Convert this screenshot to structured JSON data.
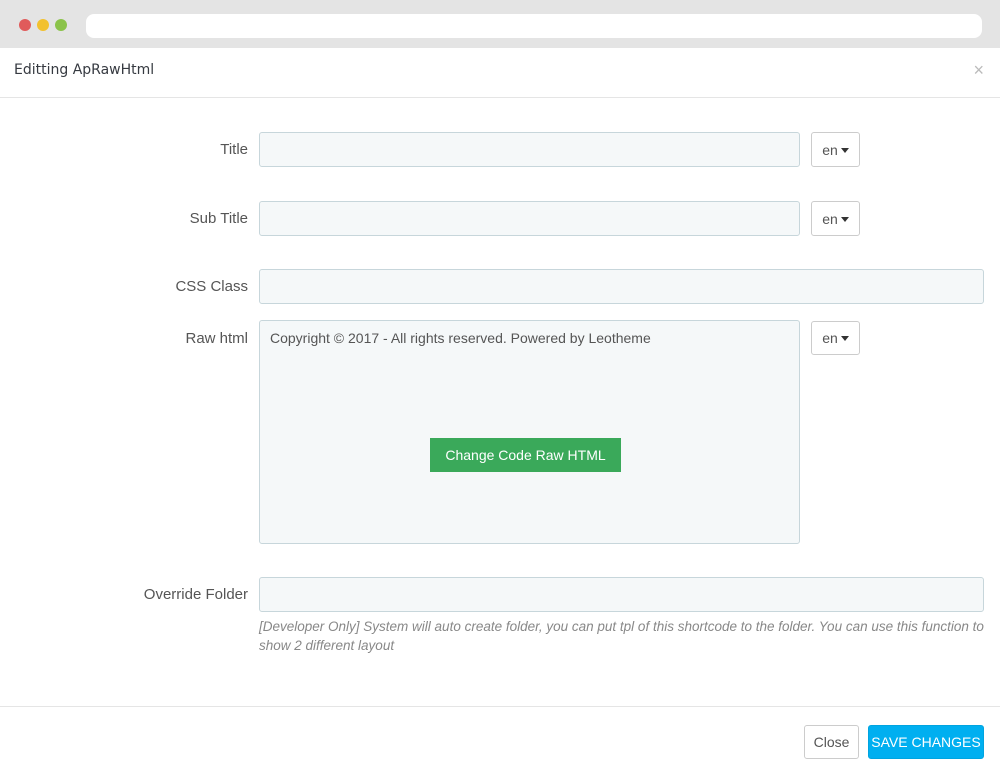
{
  "modal": {
    "title": "Editting ApRawHtml",
    "close_glyph": "×"
  },
  "form": {
    "title_label": "Title",
    "subtitle_label": "Sub Title",
    "css_class_label": "CSS Class",
    "raw_html_label": "Raw html",
    "override_folder_label": "Override Folder",
    "title_value": "",
    "subtitle_value": "",
    "css_class_value": "",
    "override_folder_value": "",
    "lang": "en",
    "raw_html_value": "Copyright © 2017 - All rights reserved. Powered by Leotheme",
    "change_code_button": "Change Code Raw HTML",
    "help_text": "[Developer Only] System will auto create folder, you can put tpl of this shortcode to the folder. You can use this function to show 2 different layout"
  },
  "footer": {
    "close_label": "Close",
    "save_label": "SAVE CHANGES"
  },
  "colors": {
    "save_button": "#00aff0",
    "change_code_button": "#3aa95a",
    "field_background": "#f5f8f9"
  },
  "icons": [
    "close-icon",
    "caret-down-icon"
  ]
}
